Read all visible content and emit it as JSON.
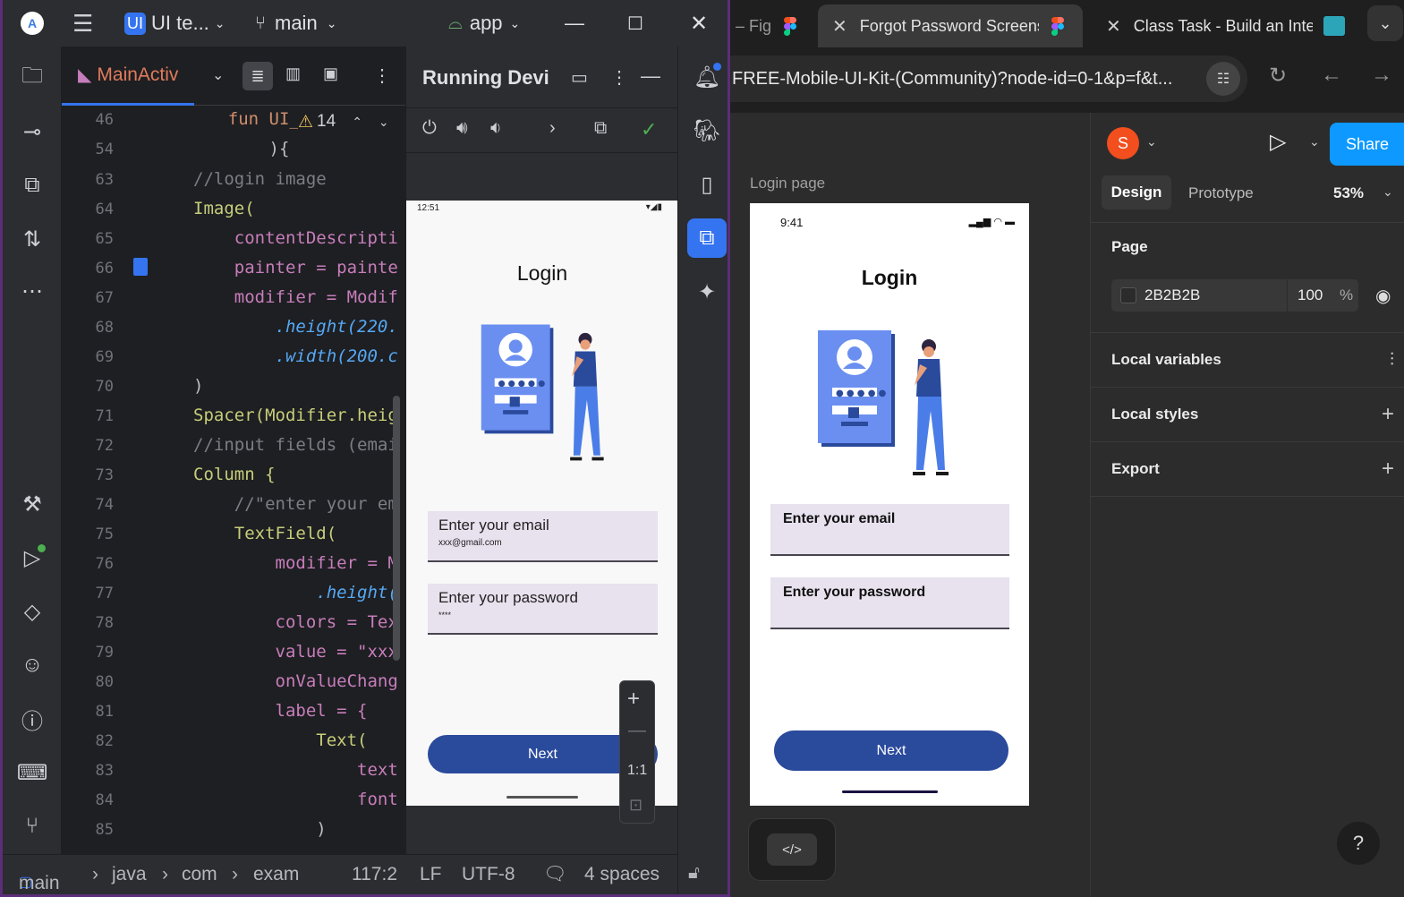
{
  "studio": {
    "project_badge": "UI",
    "project_name": "UI te...",
    "branch": "main",
    "run_config": "app",
    "editor_tab": "MainActiv",
    "inline_warning_count": "14",
    "running_title": "Running Devi",
    "line_numbers": [
      "46",
      "54",
      "63",
      "64",
      "65",
      "66",
      "67",
      "68",
      "69",
      "70",
      "71",
      "72",
      "73",
      "74",
      "75",
      "76",
      "77",
      "78",
      "79",
      "80",
      "81",
      "82",
      "83",
      "84",
      "85"
    ],
    "code_lines": [
      "    fun UI_re",
      "        ){",
      "//login image",
      "Image(",
      "    contentDescripti",
      "    painter = painte",
      "    modifier = Modif",
      "        .height(220.",
      "        .width(200.c",
      ")",
      "Spacer(Modifier.heig",
      "//input fields (emai",
      "Column {",
      "    //\"enter your em",
      "    TextField(",
      "        modifier = M",
      "            .height(",
      "        colors = Tex",
      "        value = \"xxx",
      "        onValueChang",
      "        label = {",
      "            Text(",
      "                text",
      "                font",
      "            )"
    ],
    "statusbar": {
      "module": "main",
      "crumb1": "java",
      "crumb2": "com",
      "crumb3": "exam",
      "position": "117:2",
      "line_sep": "LF",
      "encoding": "UTF-8",
      "indent": "4 spaces"
    },
    "emulator": {
      "status_time": "12:51",
      "title": "Login",
      "email_label": "Enter your email",
      "email_value": "xxx@gmail.com",
      "password_label": "Enter your password",
      "password_value": "****",
      "next_label": "Next",
      "zoom_ratio": "1:1"
    }
  },
  "browser": {
    "tabs": [
      {
        "label": "– Fig"
      },
      {
        "label": "Forgot Password Screens"
      },
      {
        "label": "Class Task - Build an Inter"
      }
    ],
    "url": "FREE-Mobile-UI-Kit-(Community)?node-id=0-1&p=f&t...",
    "figma": {
      "frame_label": "Login page",
      "avatar_letter": "S",
      "share_label": "Share",
      "tab_design": "Design",
      "tab_prototype": "Prototype",
      "zoom": "53%",
      "page_heading": "Page",
      "page_color": "2B2B2B",
      "page_opacity": "100",
      "percent_sign": "%",
      "local_variables": "Local variables",
      "local_styles": "Local styles",
      "export": "Export",
      "help": "?",
      "mockup": {
        "time": "9:41",
        "title": "Login",
        "email_label": "Enter your email",
        "password_label": "Enter your password",
        "next_label": "Next"
      }
    }
  },
  "colors": {
    "accent_blue": "#3574f0",
    "figma_share": "#0d99ff",
    "button_navy": "#2a4a9c",
    "avatar": "#f24e1e",
    "run_green": "#4caf50"
  }
}
